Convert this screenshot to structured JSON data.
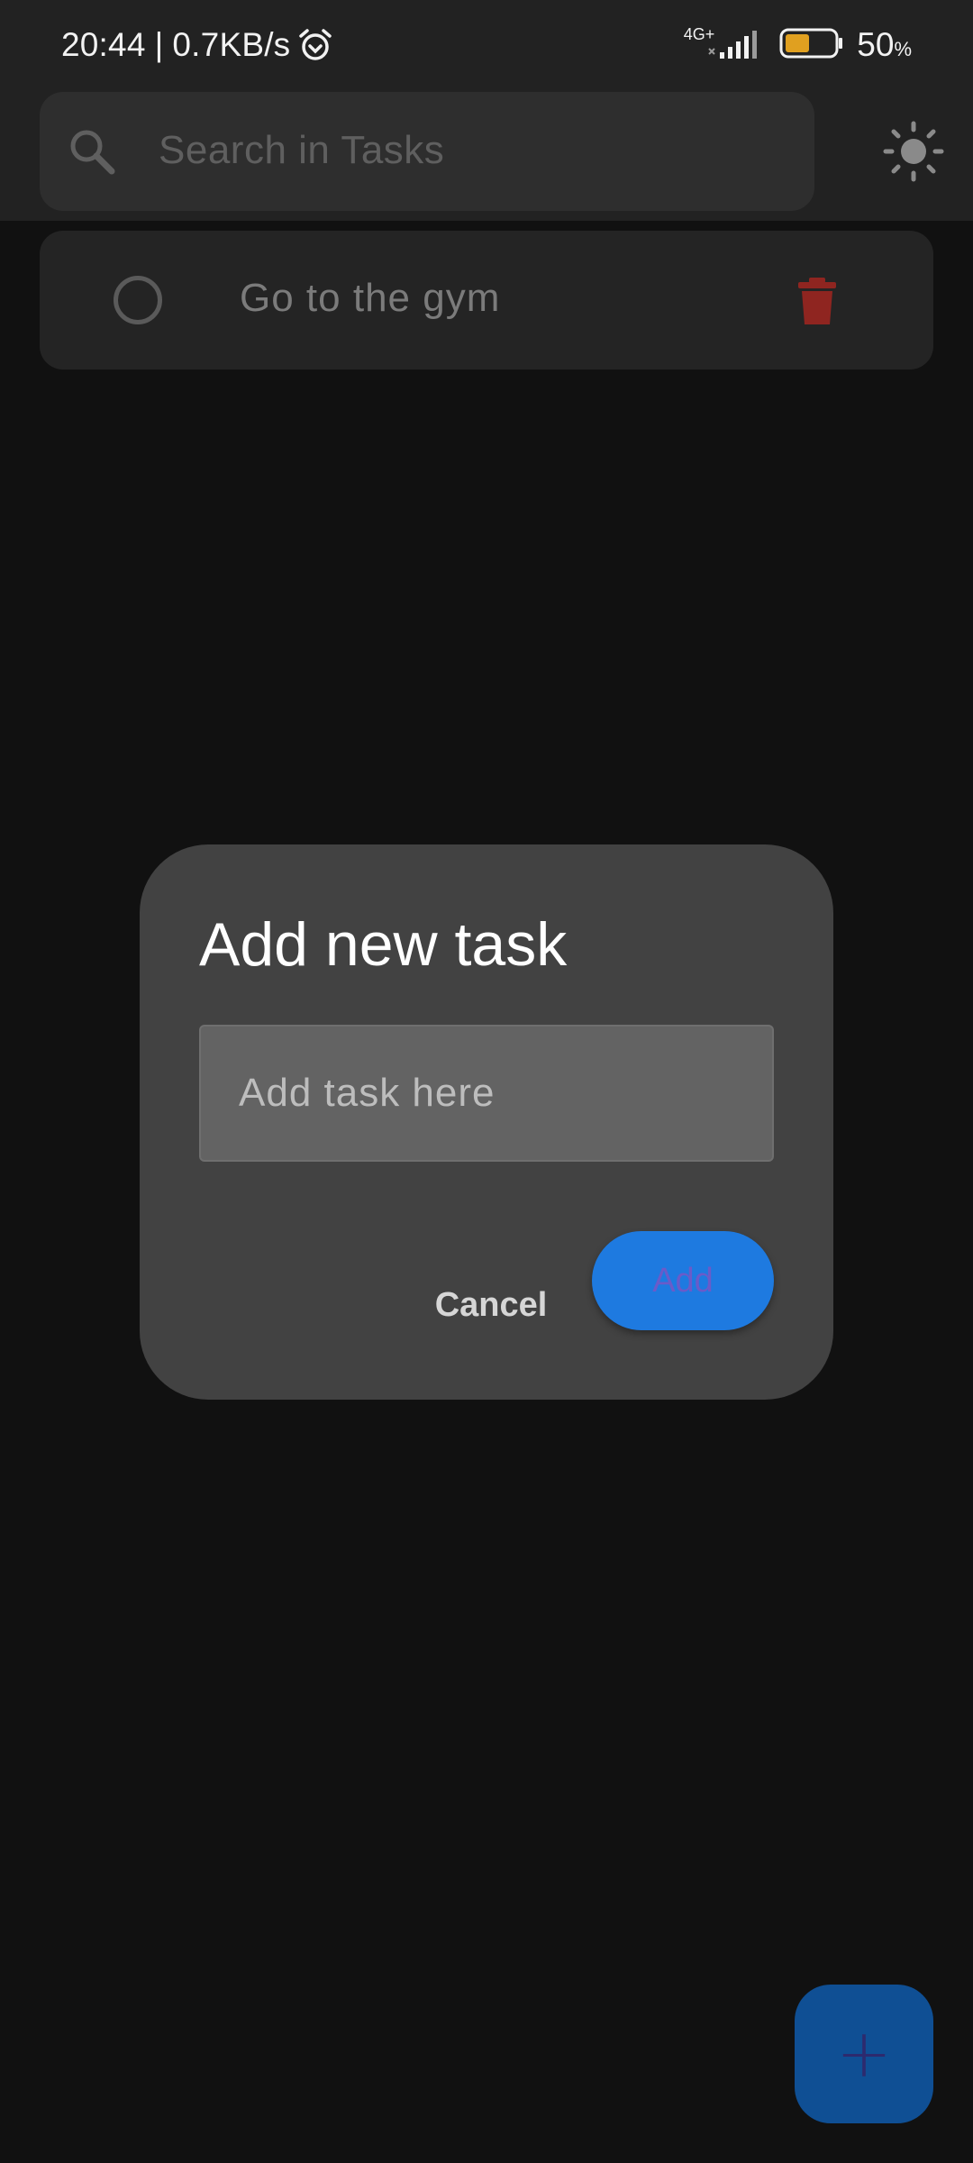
{
  "status_bar": {
    "time": "20:44",
    "separator": "|",
    "net_speed": "0.7KB/s",
    "network_type": "4G+",
    "battery_percent": "50",
    "battery_unit": "%",
    "battery_level": 0.5,
    "icons": [
      "alarm-icon",
      "signal-icon",
      "battery-icon"
    ]
  },
  "search": {
    "placeholder": "Search in Tasks",
    "icon": "search-icon"
  },
  "theme_toggle": {
    "icon": "sun-icon"
  },
  "tasks": [
    {
      "title": "Go to the gym",
      "completed": false,
      "delete_icon": "trash-icon"
    }
  ],
  "dialog": {
    "title": "Add new task",
    "input_placeholder": "Add task here",
    "input_value": "",
    "cancel_label": "Cancel",
    "add_label": "Add"
  },
  "fab": {
    "label": "+"
  },
  "colors": {
    "background": "#111111",
    "bar": "#222222",
    "accent_blue": "#1e7ae0",
    "delete_red": "#8f2520",
    "battery_fill": "#e0a020"
  }
}
